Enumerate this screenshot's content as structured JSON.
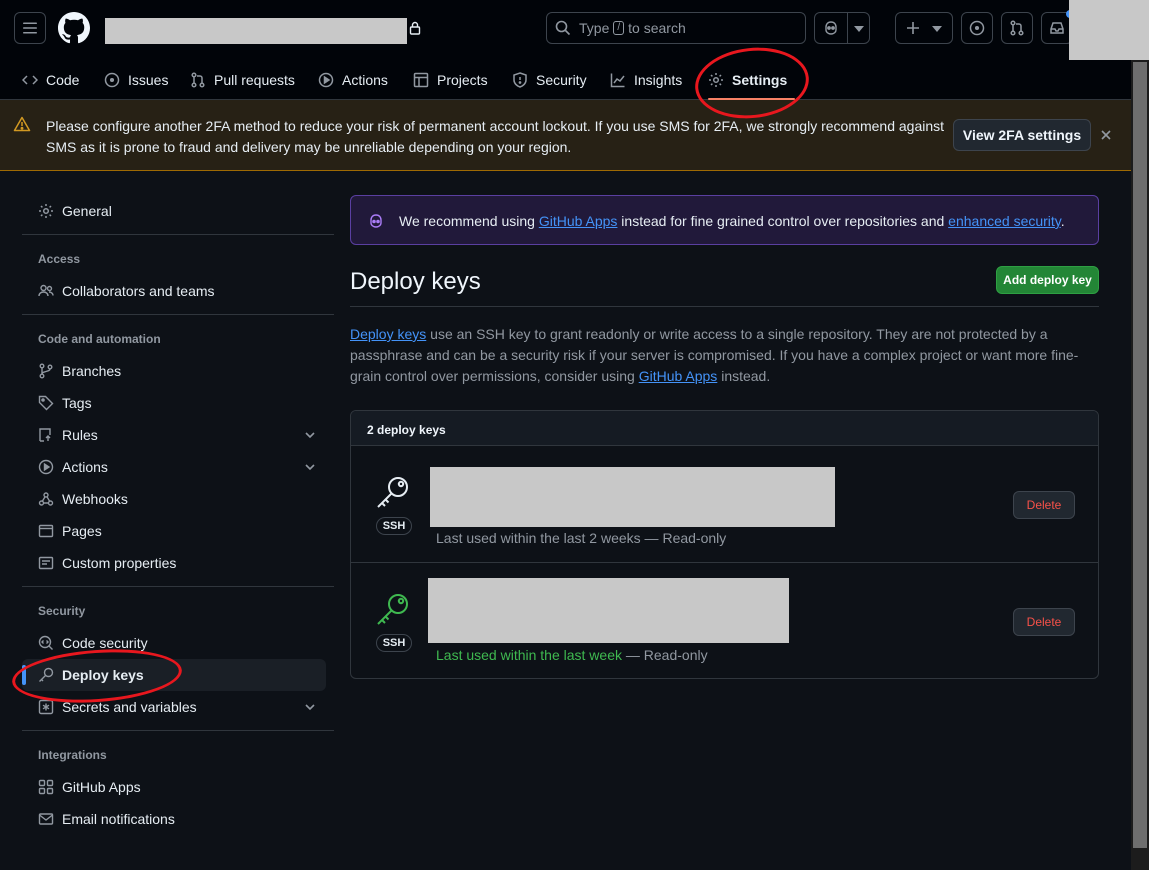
{
  "header": {
    "search": {
      "text_before": "Type",
      "key": "/",
      "text_after": "to search"
    }
  },
  "tabs": [
    {
      "label": "Code",
      "icon": "code-icon"
    },
    {
      "label": "Issues",
      "icon": "issue-opened-icon"
    },
    {
      "label": "Pull requests",
      "icon": "pull-request-icon"
    },
    {
      "label": "Actions",
      "icon": "play-icon"
    },
    {
      "label": "Projects",
      "icon": "table-icon"
    },
    {
      "label": "Security",
      "icon": "shield-icon"
    },
    {
      "label": "Insights",
      "icon": "graph-icon"
    },
    {
      "label": "Settings",
      "icon": "gear-icon",
      "active": true
    }
  ],
  "banner": {
    "message": "Please configure another 2FA method to reduce your risk of permanent account lockout. If you use SMS for 2FA, we strongly recommend against SMS as it is prone to fraud and delivery may be unreliable depending on your region.",
    "button": "View 2FA settings"
  },
  "sidebar": {
    "general": "General",
    "groups": {
      "access": "Access",
      "code_automation": "Code and automation",
      "security": "Security",
      "integrations": "Integrations"
    },
    "items": {
      "collaborators": "Collaborators and teams",
      "branches": "Branches",
      "tags": "Tags",
      "rules": "Rules",
      "actions": "Actions",
      "webhooks": "Webhooks",
      "pages": "Pages",
      "custom_properties": "Custom properties",
      "code_security": "Code security",
      "deploy_keys": "Deploy keys",
      "secrets": "Secrets and variables",
      "github_apps": "GitHub Apps",
      "email_notifications": "Email notifications"
    }
  },
  "flash": {
    "text1": "We recommend using ",
    "link1": "GitHub Apps",
    "text2": " instead for fine grained control over repositories and ",
    "link2": "enhanced security",
    "text3": "."
  },
  "main": {
    "title": "Deploy keys",
    "add_button": "Add deploy key",
    "desc_link1": "Deploy keys",
    "desc_text1": " use an SSH key to grant readonly or write access to a single repository. They are not protected by a passphrase and can be a security risk if your server is compromised. If you have a complex project or want more fine-grain control over permissions, consider using ",
    "desc_link2": "GitHub Apps",
    "desc_text2": " instead."
  },
  "keys": {
    "count_label": "2 deploy keys",
    "items": [
      {
        "type": "SSH",
        "last_used": "Last used within the last 2 weeks",
        "sep": " — ",
        "access": "Read-only",
        "delete": "Delete",
        "icon_color": "#e6edf3"
      },
      {
        "type": "SSH",
        "last_used": "Last used within the last week",
        "sep": " — ",
        "access": "Read-only",
        "delete": "Delete",
        "icon_color": "#3fb950"
      }
    ]
  }
}
